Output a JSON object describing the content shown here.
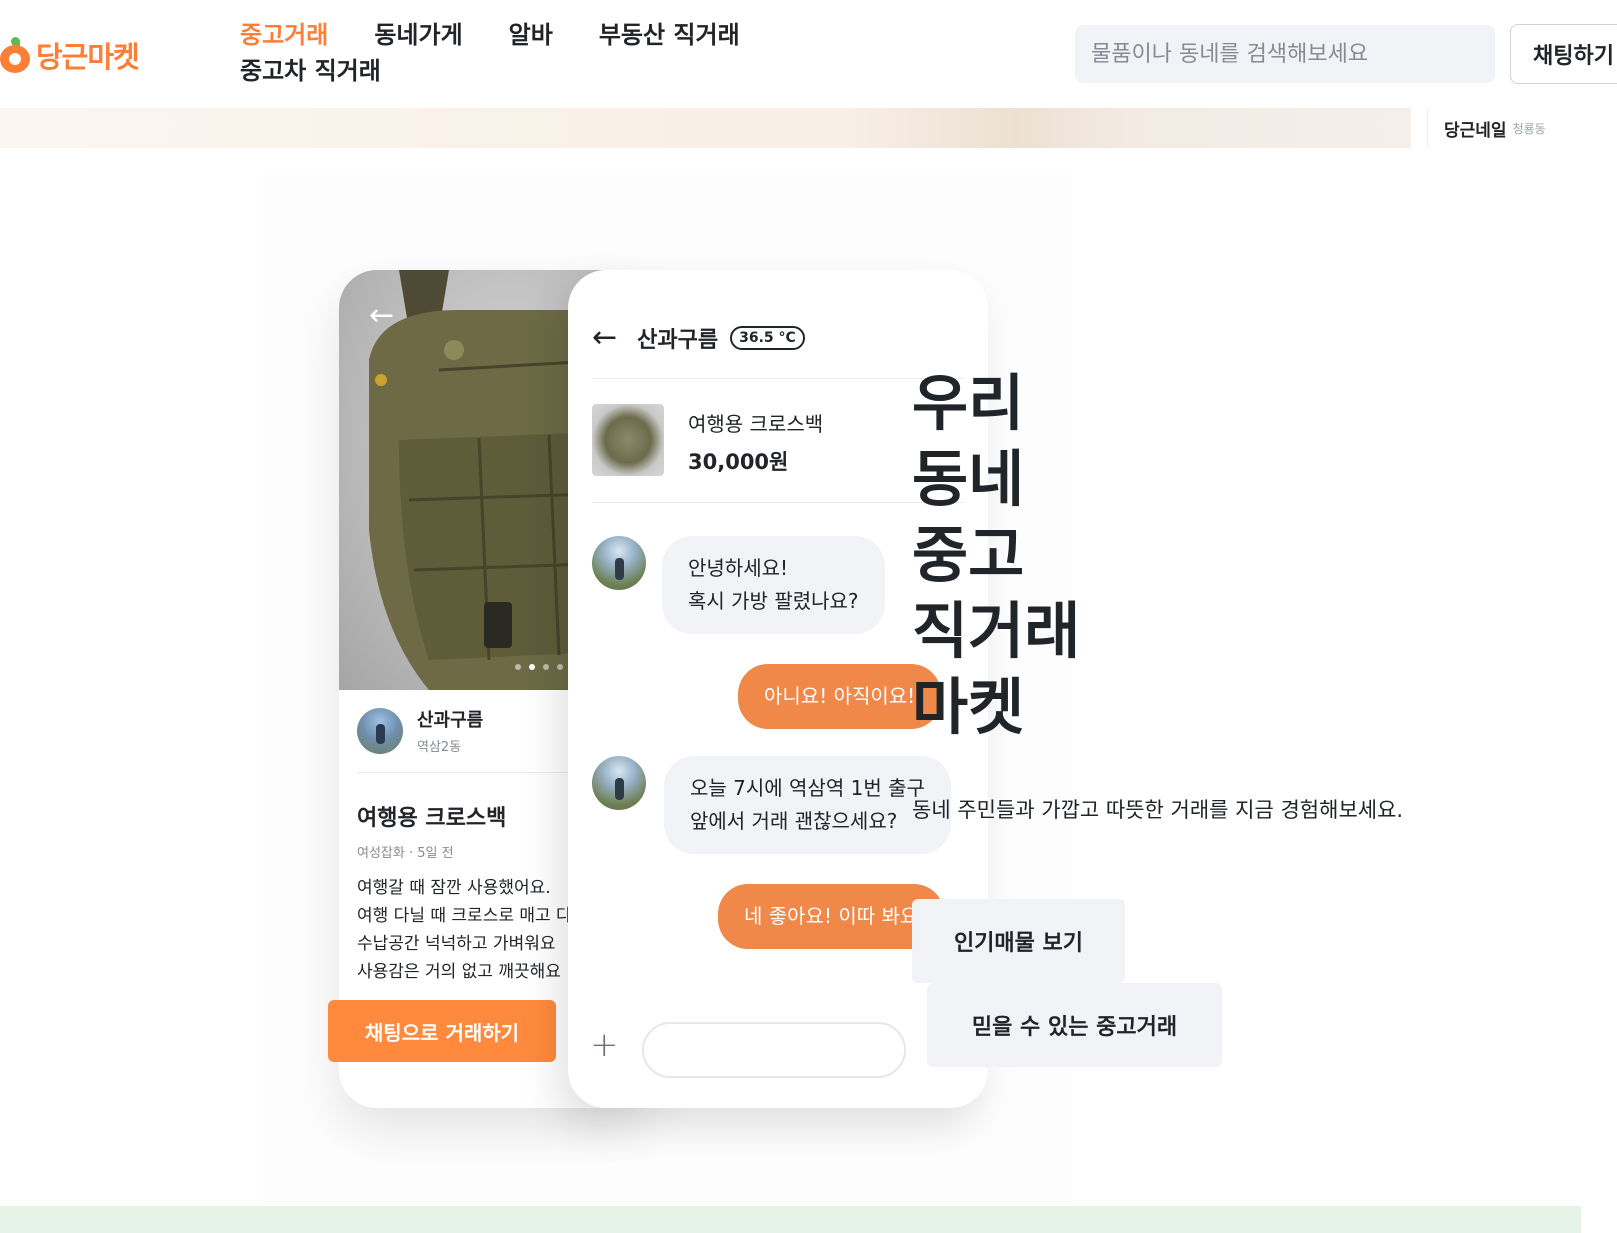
{
  "header": {
    "logo_text": "당근마켓",
    "nav": [
      "중고거래",
      "동네가게",
      "알바",
      "부동산 직거래",
      "중고차 직거래"
    ],
    "search_placeholder": "물품이나 동네를 검색해보세요",
    "chat_button": "채팅하기"
  },
  "banner": {
    "side_name": "당근네일",
    "side_sub": "청룡동"
  },
  "product_card": {
    "seller_name": "산과구름",
    "seller_location": "역삼2동",
    "title": "여행용 크로스백",
    "meta": "여성잡화 · 5일 전",
    "description": [
      "여행갈 때 잠깐 사용했어요.",
      "여행 다닐 때 크로스로 매고 다",
      "수납공간 넉넉하고 가벼워요",
      "사용감은 거의 없고 깨끗해요"
    ],
    "cta": "채팅으로 거래하기"
  },
  "chat_card": {
    "partner_name": "산과구름",
    "temperature": "36.5 °C",
    "item_name": "여행용 크로스백",
    "item_price": "30,000원",
    "messages": [
      {
        "from": "them",
        "lines": [
          "안녕하세요!",
          "혹시 가방 팔렸나요?"
        ]
      },
      {
        "from": "me",
        "lines": [
          "아니요! 아직이요!"
        ]
      },
      {
        "from": "them",
        "lines": [
          "오늘 7시에 역삼역 1번 출구",
          "앞에서 거래 괜찮으세요?"
        ]
      },
      {
        "from": "me",
        "lines": [
          "네 좋아요! 이따 봐요"
        ]
      }
    ]
  },
  "hero": {
    "title": "우리 동네 중고 직거래 마켓",
    "subtitle": "동네 주민들과 가깝고 따뜻한 거래를 지금 경험해보세요.",
    "button_popular": "인기매물 보기",
    "button_trust": "믿을 수 있는 중고거래"
  },
  "colors": {
    "brand_orange": "#ff7e36",
    "bubble_orange": "#f0884a",
    "bubble_gray": "#f2f3f6"
  }
}
